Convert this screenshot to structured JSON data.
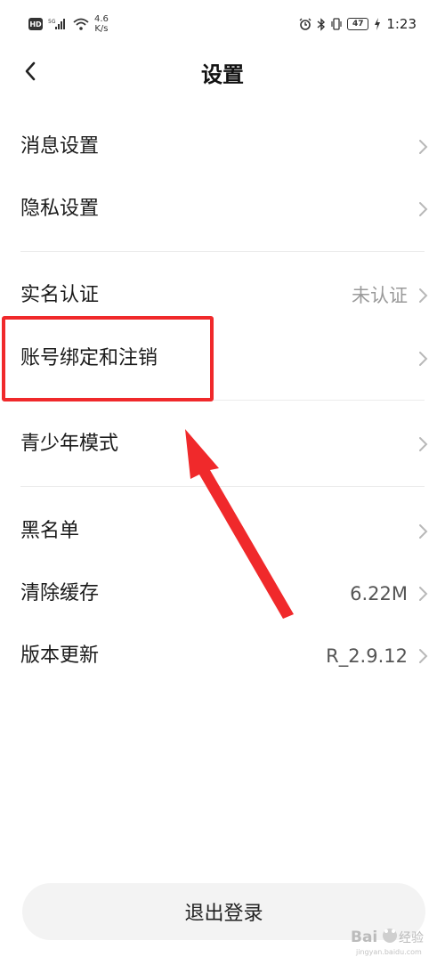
{
  "status_bar": {
    "hd": "HD",
    "net_speed_value": "4.6",
    "net_speed_unit": "K/s",
    "battery": "47",
    "time": "1:23"
  },
  "header": {
    "title": "设置"
  },
  "rows": [
    {
      "label": "消息设置",
      "value": ""
    },
    {
      "label": "隐私设置",
      "value": ""
    },
    {
      "label": "实名认证",
      "value": "未认证"
    },
    {
      "label": "账号绑定和注销",
      "value": ""
    },
    {
      "label": "青少年模式",
      "value": ""
    },
    {
      "label": "黑名单",
      "value": ""
    },
    {
      "label": "清除缓存",
      "value": "6.22M"
    },
    {
      "label": "版本更新",
      "value": "R_2.9.12"
    }
  ],
  "logout_label": "退出登录",
  "watermark": {
    "text": "Bai du 经验",
    "url": "jingyan.baidu.com"
  },
  "colors": {
    "highlight": "#f0292b",
    "chevron": "#b8b8b8"
  }
}
